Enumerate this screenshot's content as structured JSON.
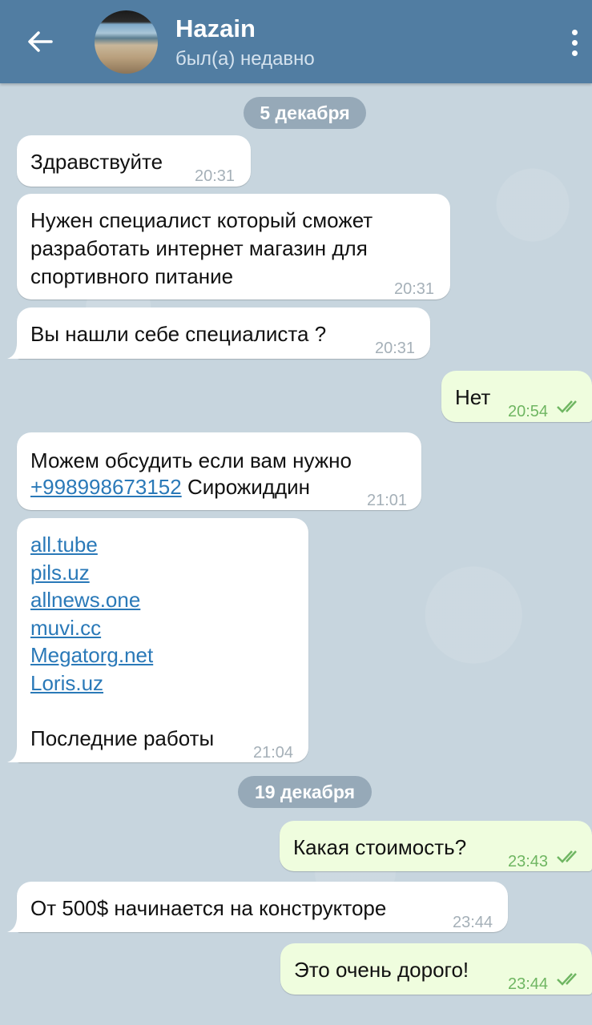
{
  "header": {
    "back_icon": "arrow-left-icon",
    "contact_name": "Hazain",
    "status": "был(а) недавно",
    "menu_icon": "more-vertical-icon"
  },
  "colors": {
    "header_bg": "#517da2",
    "incoming_bubble": "#ffffff",
    "outgoing_bubble": "#effdde",
    "link": "#2a79b8",
    "read_check": "#6fb662"
  },
  "dates": [
    "5 декабря",
    "19 декабря"
  ],
  "messages": [
    {
      "dir": "in",
      "text": "Здравствуйте",
      "time": "20:31"
    },
    {
      "dir": "in",
      "lines": [
        "Нужен специалист который сможет",
        "разработать интернет магазин для",
        "спортивного питание"
      ],
      "time": "20:31"
    },
    {
      "dir": "in",
      "text": "Вы нашли себе специалиста ?",
      "time": "20:31"
    },
    {
      "dir": "out",
      "text": "Нет",
      "time": "20:54",
      "status": "read"
    },
    {
      "dir": "in",
      "line1": "Можем обсудить если вам нужно",
      "phone": "+998998673152",
      "name": "Сирожиддин",
      "time": "21:01"
    },
    {
      "dir": "in",
      "links": [
        "all.tube",
        "pils.uz",
        "allnews.one",
        "muvi.cc",
        "Megatorg.net",
        "Loris.uz"
      ],
      "text": "Последние работы",
      "time": "21:04"
    },
    {
      "dir": "out",
      "text": "Какая стоимость?",
      "time": "23:43",
      "status": "read"
    },
    {
      "dir": "in",
      "text": "От 500$ начинается на конструкторе",
      "time": "23:44"
    },
    {
      "dir": "out",
      "text": "Это очень дорого!",
      "time": "23:44",
      "status": "read"
    }
  ]
}
